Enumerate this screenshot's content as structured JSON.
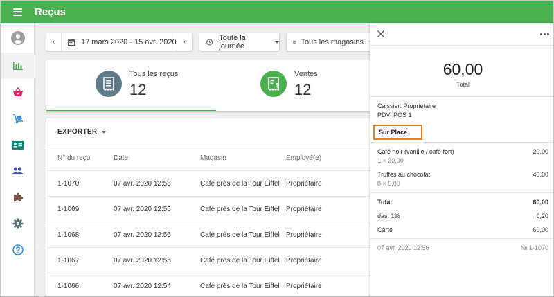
{
  "app": {
    "title": "Reçus"
  },
  "filters": {
    "date_range": "17 mars 2020 - 15 avr. 2020",
    "time": "Toute la journée",
    "stores": "Tous les magasins"
  },
  "stats": {
    "all_receipts": {
      "label": "Tous les reçus",
      "value": "12"
    },
    "sales": {
      "label": "Ventes",
      "value": "12"
    }
  },
  "table": {
    "export_label": "EXPORTER",
    "columns": [
      "N° du reçu",
      "Date",
      "Magasin",
      "Employé(e)"
    ],
    "rows": [
      [
        "1-1070",
        "07 avr. 2020 12:56",
        "Café près de la Tour Eiffel",
        "Propriétaire"
      ],
      [
        "1-1069",
        "07 avr. 2020 12:56",
        "Café près de la Tour Eiffel",
        "Propriétaire"
      ],
      [
        "1-1068",
        "07 avr. 2020 12:56",
        "Café près de la Tour Eiffel",
        "Propriétaire"
      ],
      [
        "1-1067",
        "07 avr. 2020 12:55",
        "Café près de la Tour Eiffel",
        "Propriétaire"
      ],
      [
        "1-1066",
        "07 avr. 2020 12:54",
        "Café près de la Tour Eiffel",
        "Propriétaire"
      ]
    ]
  },
  "receipt": {
    "total": "60,00",
    "total_label": "Total",
    "cashier": "Caissier: Propriétaire",
    "pos": "PDV: POS 1",
    "dining_option": "Sur Place",
    "items": [
      {
        "name": "Café noir (vanille / café fort)",
        "detail": "1 × 20,00",
        "price": "20,00"
      },
      {
        "name": "Truffes au chocolat",
        "detail": "8 × 5,00",
        "price": "40,00"
      }
    ],
    "summary_total_label": "Total",
    "summary_total": "60,00",
    "tax_label": "das. 1%",
    "tax": "0,20",
    "payment_label": "Carte",
    "payment": "60,00",
    "date": "07 avr. 2020 12:56",
    "number": "№ 1-1070"
  },
  "colors": {
    "brand": "#4caf50",
    "highlight": "#e67e22",
    "receipts_icon": "#5f7b8a",
    "sales_icon": "#4caf50"
  },
  "icons": {
    "nav": [
      "account-icon",
      "bar-chart-icon",
      "basket-icon",
      "dolly-icon",
      "id-card-icon",
      "people-icon",
      "puzzle-icon",
      "gear-icon",
      "help-icon"
    ]
  }
}
